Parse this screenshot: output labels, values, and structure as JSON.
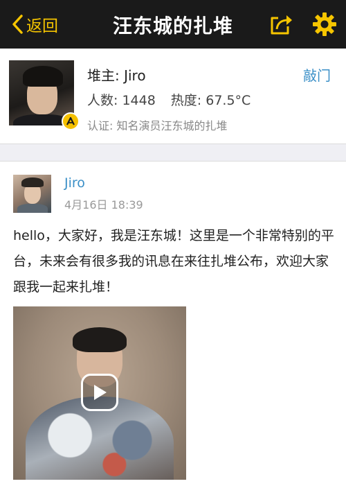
{
  "navbar": {
    "back_label": "返回",
    "title": "汪东城的扎堆",
    "share_icon": "share-icon",
    "settings_icon": "gear-icon",
    "accent_color": "#f6c500"
  },
  "pile": {
    "owner_label": "堆主: Jiro",
    "knock_label": "敲门",
    "members": "人数: 1448",
    "heat": "热度: 67.5°C",
    "certification": "认证: 知名演员汪东城的扎堆",
    "badge_icon": "verified-badge-icon"
  },
  "post": {
    "author": "Jiro",
    "time": "4月16日 18:39",
    "text": "hello，大家好，我是汪东城！这里是一个非常特别的平台，未来会有很多我的讯息在来往扎堆公布，欢迎大家跟我一起来扎堆！",
    "video_icon": "play-icon"
  },
  "colors": {
    "link": "#3a8fc7",
    "navbar_bg": "#1a1a1a"
  }
}
